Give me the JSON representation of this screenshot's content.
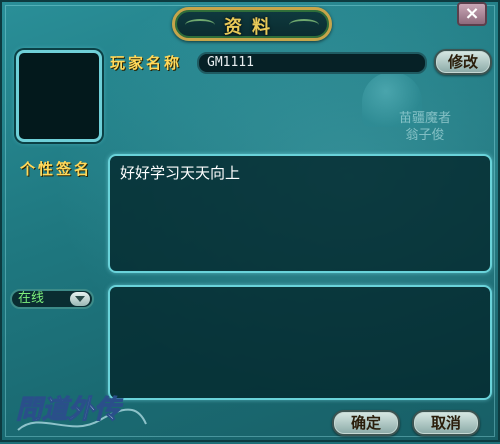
{
  "dialog": {
    "title": "资料",
    "close_symbol": "×"
  },
  "profile": {
    "name_label": "玩家名称",
    "name_value": "GM1111",
    "edit_button": "修改",
    "signature_label": "个性签名",
    "signature_text": "好好学习天天向上"
  },
  "status": {
    "selected": "在线"
  },
  "background": {
    "npc_line1": "苗疆魔者",
    "npc_line2": "翁子俊"
  },
  "footer": {
    "confirm_button": "确定",
    "cancel_button": "取消",
    "logo_text": "問道外传"
  },
  "icons": {
    "close": "close-icon",
    "dropdown": "chevron-down-icon"
  },
  "colors": {
    "panel": "#1f7880",
    "accent_gold": "#ffd85a",
    "border_cyan": "#6ad3da",
    "status_green": "#7df07d"
  }
}
